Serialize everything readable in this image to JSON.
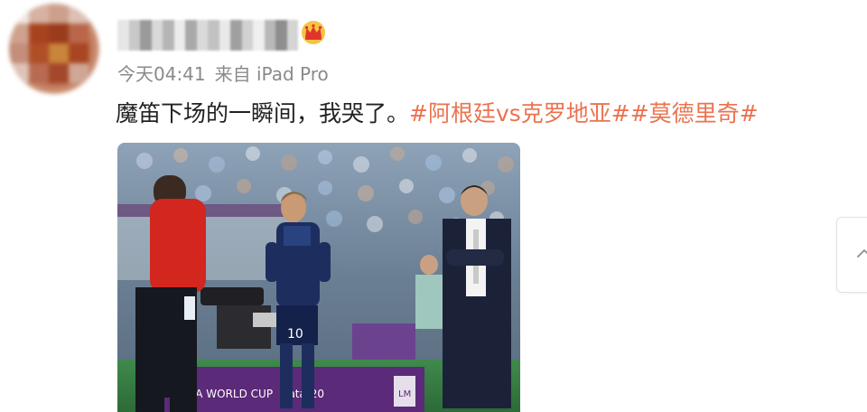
{
  "post": {
    "avatar_icon": "avatar-icon",
    "username_obscured": true,
    "badge_icon": "crown-icon",
    "timestamp": "今天04:41",
    "source": "来自 iPad Pro",
    "text_main": "魔笛下场的一瞬间，我哭了。",
    "topics": [
      "#阿根廷vs克罗地亚#",
      "#莫德里奇#"
    ],
    "topic_color": "#eb7350"
  },
  "photo": {
    "banner_left": "FIFA WORLD CUP",
    "banner_right": "Qatar20",
    "jersey_number": "10",
    "ad_tag": "LM"
  },
  "side_button": {
    "icon": "chevron-up-icon"
  }
}
